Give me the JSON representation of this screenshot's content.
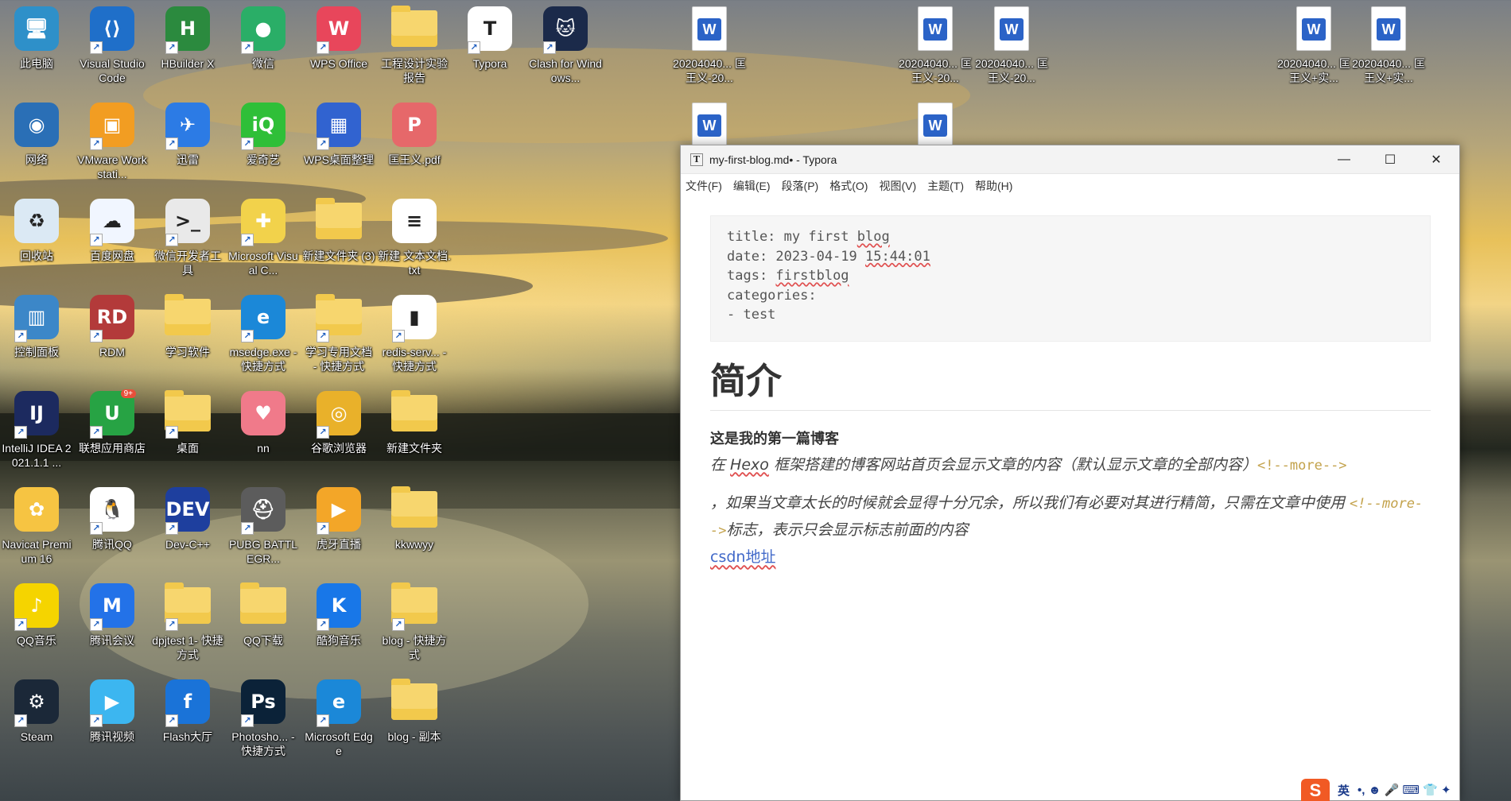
{
  "desktop": {
    "icons": [
      {
        "id": "this-pc",
        "label": "此电脑",
        "x": 0,
        "y": 0,
        "type": "monitor",
        "icon": "monitor-icon",
        "shortcut": false
      },
      {
        "id": "vscode",
        "label": "Visual Studio Code",
        "x": 1,
        "y": 0,
        "type": "vscode",
        "icon": "vscode-icon",
        "shortcut": true
      },
      {
        "id": "hbuilder",
        "label": "HBuilder X",
        "x": 2,
        "y": 0,
        "type": "hbuilder",
        "icon": "hbuilder-icon",
        "shortcut": true
      },
      {
        "id": "wechat",
        "label": "微信",
        "x": 3,
        "y": 0,
        "type": "wechat",
        "icon": "wechat-icon",
        "shortcut": true
      },
      {
        "id": "wps",
        "label": "WPS Office",
        "x": 4,
        "y": 0,
        "type": "wps",
        "icon": "wps-icon",
        "shortcut": true
      },
      {
        "id": "eng-design",
        "label": "工程设计实验报告",
        "x": 5,
        "y": 0,
        "type": "folder",
        "icon": "folder-icon",
        "shortcut": false
      },
      {
        "id": "typora",
        "label": "Typora",
        "x": 6,
        "y": 0,
        "type": "typora",
        "icon": "typora-icon",
        "shortcut": true
      },
      {
        "id": "clash",
        "label": "Clash for Windows...",
        "x": 7,
        "y": 0,
        "type": "clash",
        "icon": "clash-cat-icon",
        "shortcut": true
      },
      {
        "id": "network",
        "label": "网络",
        "x": 0,
        "y": 1,
        "type": "network",
        "icon": "network-globe-icon",
        "shortcut": false
      },
      {
        "id": "vmware",
        "label": "VMware Workstati...",
        "x": 1,
        "y": 1,
        "type": "vmware",
        "icon": "vmware-icon",
        "shortcut": true
      },
      {
        "id": "xunlei",
        "label": "迅雷",
        "x": 2,
        "y": 1,
        "type": "xunlei",
        "icon": "xunlei-bird-icon",
        "shortcut": true
      },
      {
        "id": "iqiyi",
        "label": "爱奇艺",
        "x": 3,
        "y": 1,
        "type": "iqiyi",
        "icon": "iqiyi-icon",
        "shortcut": true
      },
      {
        "id": "wps-desk",
        "label": "WPS桌面整理",
        "x": 4,
        "y": 1,
        "type": "wpsdesk",
        "icon": "wps-desk-icon",
        "shortcut": true
      },
      {
        "id": "pdf",
        "label": "匡王义.pdf",
        "x": 5,
        "y": 1,
        "type": "pdf",
        "icon": "pdf-file-icon",
        "shortcut": false
      },
      {
        "id": "recycle",
        "label": "回收站",
        "x": 0,
        "y": 2,
        "type": "recycle",
        "icon": "recycle-bin-icon",
        "shortcut": false
      },
      {
        "id": "baidu-pan",
        "label": "百度网盘",
        "x": 1,
        "y": 2,
        "type": "baidupan",
        "icon": "baidu-netdisk-icon",
        "shortcut": true
      },
      {
        "id": "wx-dev",
        "label": "微信开发者工具",
        "x": 2,
        "y": 2,
        "type": "wxdev",
        "icon": "wechat-devtools-icon",
        "shortcut": true
      },
      {
        "id": "msvc",
        "label": "Microsoft Visual C...",
        "x": 3,
        "y": 2,
        "type": "msvc",
        "icon": "visual-c-icon",
        "shortcut": true
      },
      {
        "id": "new-folder-3",
        "label": "新建文件夹 (3)",
        "x": 4,
        "y": 2,
        "type": "folder",
        "icon": "folder-icon",
        "shortcut": false
      },
      {
        "id": "new-txt",
        "label": "新建 文本文档.txt",
        "x": 5,
        "y": 2,
        "type": "txt",
        "icon": "text-file-icon",
        "shortcut": false
      },
      {
        "id": "control-panel",
        "label": "控制面板",
        "x": 0,
        "y": 3,
        "type": "control",
        "icon": "control-panel-icon",
        "shortcut": true
      },
      {
        "id": "rdm",
        "label": "RDM",
        "x": 1,
        "y": 3,
        "type": "rdm",
        "icon": "rdm-icon",
        "shortcut": true
      },
      {
        "id": "study-soft",
        "label": "学习软件",
        "x": 2,
        "y": 3,
        "type": "folder",
        "icon": "folder-icon",
        "shortcut": false
      },
      {
        "id": "msedge-exe",
        "label": "msedge.exe - 快捷方式",
        "x": 3,
        "y": 3,
        "type": "edge",
        "icon": "edge-icon",
        "shortcut": true
      },
      {
        "id": "study-docs",
        "label": "学习专用文档 - 快捷方式",
        "x": 4,
        "y": 3,
        "type": "folder",
        "icon": "folder-icon",
        "shortcut": true
      },
      {
        "id": "redis",
        "label": "redis-serv... - 快捷方式",
        "x": 5,
        "y": 3,
        "type": "redis",
        "icon": "redis-server-icon",
        "shortcut": true
      },
      {
        "id": "idea",
        "label": "IntelliJ IDEA 2021.1.1 ...",
        "x": 0,
        "y": 4,
        "type": "idea",
        "icon": "intellij-idea-icon",
        "shortcut": true
      },
      {
        "id": "lenovo-store",
        "label": "联想应用商店",
        "x": 1,
        "y": 4,
        "type": "lenovo",
        "icon": "lenovo-store-icon",
        "shortcut": true,
        "badge": "9+"
      },
      {
        "id": "desktop-folder",
        "label": "桌面",
        "x": 2,
        "y": 4,
        "type": "folder",
        "icon": "folder-icon",
        "shortcut": true
      },
      {
        "id": "nn",
        "label": "nn",
        "x": 3,
        "y": 4,
        "type": "nn",
        "icon": "nn-icon",
        "shortcut": false
      },
      {
        "id": "chrome",
        "label": "谷歌浏览器",
        "x": 4,
        "y": 4,
        "type": "chrome",
        "icon": "chrome-icon",
        "shortcut": true
      },
      {
        "id": "new-folder",
        "label": "新建文件夹",
        "x": 5,
        "y": 4,
        "type": "folder",
        "icon": "folder-icon",
        "shortcut": false
      },
      {
        "id": "navicat",
        "label": "Navicat Premium 16",
        "x": 0,
        "y": 5,
        "type": "navicat",
        "icon": "navicat-icon",
        "shortcut": false
      },
      {
        "id": "qq",
        "label": "腾讯QQ",
        "x": 1,
        "y": 5,
        "type": "qq",
        "icon": "qq-penguin-icon",
        "shortcut": true
      },
      {
        "id": "devcpp",
        "label": "Dev-C++",
        "x": 2,
        "y": 5,
        "type": "devcpp",
        "icon": "dev-cpp-icon",
        "shortcut": true
      },
      {
        "id": "pubg",
        "label": "PUBG BATTLEGR...",
        "x": 3,
        "y": 5,
        "type": "pubg",
        "icon": "pubg-helmet-icon",
        "shortcut": true
      },
      {
        "id": "huya",
        "label": "虎牙直播",
        "x": 4,
        "y": 5,
        "type": "huya",
        "icon": "huya-icon",
        "shortcut": true
      },
      {
        "id": "kkwwyy",
        "label": "kkwwyy",
        "x": 5,
        "y": 5,
        "type": "folder",
        "icon": "folder-icon",
        "shortcut": false
      },
      {
        "id": "qqmusic",
        "label": "QQ音乐",
        "x": 0,
        "y": 6,
        "type": "qqmusic",
        "icon": "qq-music-icon",
        "shortcut": true
      },
      {
        "id": "tencent-meeting",
        "label": "腾讯会议",
        "x": 1,
        "y": 6,
        "type": "meeting",
        "icon": "tencent-meeting-icon",
        "shortcut": true
      },
      {
        "id": "dpjtest",
        "label": "dpjtest 1- 快捷方式",
        "x": 2,
        "y": 6,
        "type": "folder",
        "icon": "folder-icon",
        "shortcut": true
      },
      {
        "id": "qq-download",
        "label": "QQ下载",
        "x": 3,
        "y": 6,
        "type": "folder",
        "icon": "folder-icon",
        "shortcut": false
      },
      {
        "id": "kugou",
        "label": "酷狗音乐",
        "x": 4,
        "y": 6,
        "type": "kugou",
        "icon": "kugou-icon",
        "shortcut": true
      },
      {
        "id": "blog-shortcut",
        "label": "blog - 快捷方式",
        "x": 5,
        "y": 6,
        "type": "folder",
        "icon": "folder-icon",
        "shortcut": true
      },
      {
        "id": "steam",
        "label": "Steam",
        "x": 0,
        "y": 7,
        "type": "steam",
        "icon": "steam-icon",
        "shortcut": true
      },
      {
        "id": "tencent-video",
        "label": "腾讯视频",
        "x": 1,
        "y": 7,
        "type": "tvideo",
        "icon": "tencent-video-icon",
        "shortcut": true
      },
      {
        "id": "flash",
        "label": "Flash大厅",
        "x": 2,
        "y": 7,
        "type": "flash",
        "icon": "flash-icon",
        "shortcut": true
      },
      {
        "id": "photoshop",
        "label": "Photosho... - 快捷方式",
        "x": 3,
        "y": 7,
        "type": "ps",
        "icon": "photoshop-icon",
        "shortcut": true
      },
      {
        "id": "edge",
        "label": "Microsoft Edge",
        "x": 4,
        "y": 7,
        "type": "edge",
        "icon": "edge-icon",
        "shortcut": true
      },
      {
        "id": "blog-copy",
        "label": "blog - 副本",
        "x": 5,
        "y": 7,
        "type": "folder",
        "icon": "folder-icon",
        "shortcut": false
      }
    ],
    "right_icons": [
      {
        "id": "w1",
        "label": "20204040... 匡王义-20...",
        "icon": "word-doc-icon"
      },
      {
        "id": "w2",
        "label": "20204040... 匡王义-20...",
        "icon": "word-doc-icon"
      },
      {
        "id": "w3",
        "label": "20204040... 匡王义-20...",
        "icon": "word-doc-icon"
      },
      {
        "id": "w4",
        "label": "20204040... 匡王义+实...",
        "icon": "word-doc-icon"
      },
      {
        "id": "w5",
        "label": "20204040... 匡王义+实...",
        "icon": "word-doc-icon"
      },
      {
        "id": "w6",
        "label": "",
        "icon": "word-doc-icon"
      },
      {
        "id": "w7",
        "label": "",
        "icon": "word-doc-icon"
      }
    ]
  },
  "window": {
    "title": "my-first-blog.md• - Typora",
    "menu": [
      "文件(F)",
      "编辑(E)",
      "段落(P)",
      "格式(O)",
      "视图(V)",
      "主题(T)",
      "帮助(H)"
    ],
    "controls": {
      "minimize": "—",
      "maximize": "☐",
      "close": "✕"
    }
  },
  "document": {
    "front_matter": {
      "l1_key": "title: my first ",
      "l1_sq": "blog",
      "l2_key": "date: 2023-04-19 ",
      "l2_sq": "15:44:01",
      "l3_key": "tags: ",
      "l3_sq": "firstblog",
      "l4": "categories:",
      "l5": "- test"
    },
    "heading": "简介",
    "bold_line": "这是我的第一篇博客",
    "italic_1_pre": "在 ",
    "italic_1_sq": "Hexo",
    "italic_1_post": " 框架搭建的博客网站首页会显示文章的内容（默认显示文章的全部内容）",
    "italic_1_code": "<!--more-->",
    "italic_2_pre": "，如果当文章太长的时候就会显得十分冗余，所以我们有必要对其进行精简，只需在文章中使用 ",
    "italic_2_code": "<!--more-->",
    "italic_2_post": "标志，表示只会显示标志前面的内容",
    "link": "csdn地址"
  },
  "tray": {
    "ime": "S",
    "lang": "英",
    "symbols": "•, ☻ 🎤 ⌨ 👕 ✦"
  }
}
